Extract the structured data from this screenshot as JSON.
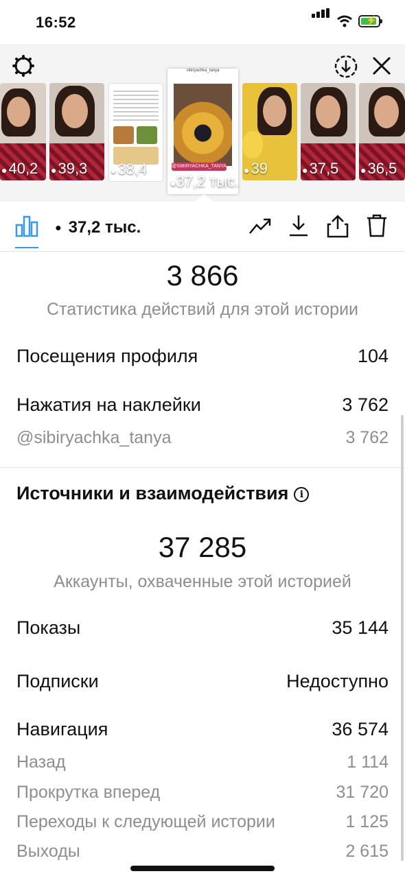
{
  "status_bar": {
    "time": "16:52"
  },
  "stories": [
    {
      "count": "40,2"
    },
    {
      "count": "39,3"
    },
    {
      "count": "38,4"
    },
    {
      "count": "37,2 тыс.",
      "tag": "@SIBIRYACHKA_TANYA",
      "header": "sibiryachka_tanya"
    },
    {
      "count": "39"
    },
    {
      "count": "37,5"
    },
    {
      "count": "36,5"
    }
  ],
  "toolbar": {
    "views": "37,2 тыс."
  },
  "story_stats": {
    "total": "3 866",
    "caption": "Статистика действий для этой истории",
    "rows": [
      {
        "label": "Посещения профиля",
        "value": "104"
      },
      {
        "label": "Нажатия на наклейки",
        "value": "3 762"
      }
    ],
    "sub": {
      "label": "@sibiryachka_tanya",
      "value": "3 762"
    }
  },
  "reach": {
    "title": "Источники и взаимодействия",
    "total": "37 285",
    "caption": "Аккаунты, охваченные этой историей",
    "rows": [
      {
        "label": "Показы",
        "value": "35 144"
      },
      {
        "label": "Подписки",
        "value": "Недоступно"
      },
      {
        "label": "Навигация",
        "value": "36 574"
      }
    ],
    "nav_details": [
      {
        "label": "Назад",
        "value": "1 114"
      },
      {
        "label": "Прокрутка вперед",
        "value": "31 720"
      },
      {
        "label": "Переходы к следующей истории",
        "value": "1 125"
      },
      {
        "label": "Выходы",
        "value": "2 615"
      }
    ]
  },
  "colors": {
    "accent": "#3897f0",
    "battery": "#3cc24a"
  }
}
